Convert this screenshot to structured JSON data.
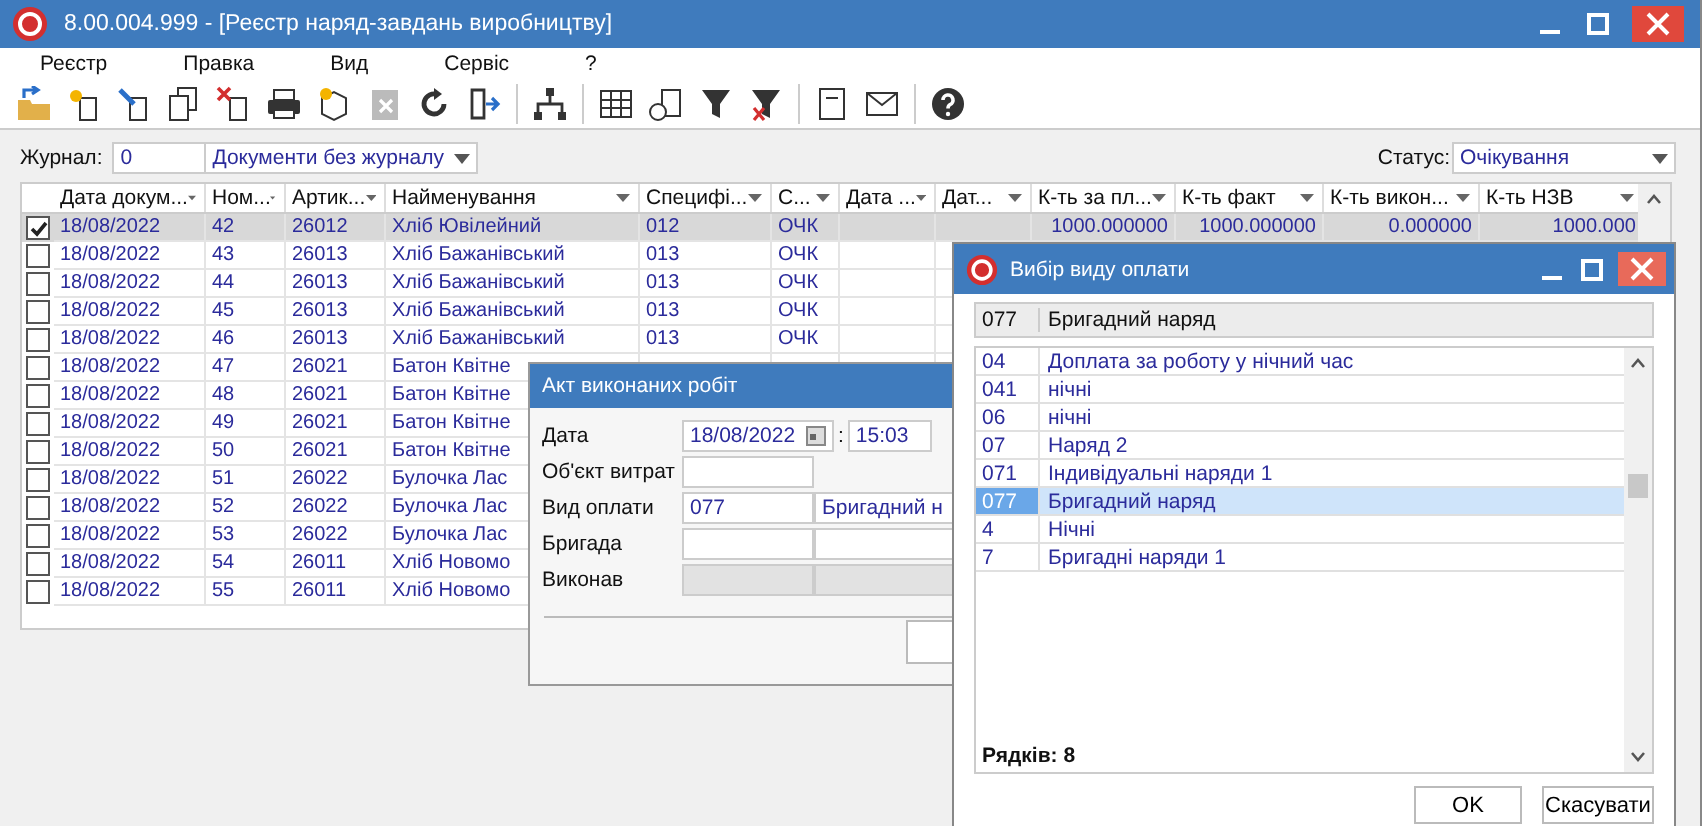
{
  "window": {
    "title": "8.00.004.999 - [Реєстр наряд-завдань виробництву]"
  },
  "menu": [
    "Реєстр",
    "Правка",
    "Вид",
    "Сервіс",
    "?"
  ],
  "journal": {
    "label": "Журнал:",
    "code": "0",
    "value": "Документи без журналу"
  },
  "status": {
    "label": "Статус:",
    "value": "Очікування"
  },
  "table": {
    "columns": [
      "Дата докум...",
      "Ном...",
      "Артик...",
      "Найменування",
      "Специфі...",
      "С...",
      "Дата ...",
      "Дат...",
      "К-ть за пл...",
      "К-ть факт",
      "К-ть викон...",
      "К-ть НЗВ"
    ],
    "rows": [
      {
        "checked": true,
        "selected": true,
        "date": "18/08/2022",
        "number": "42",
        "article": "26012",
        "name": "Хліб Ювілейний",
        "spec": "012",
        "status": "ОЧК",
        "planned": "1000.000000",
        "actual": "1000.000000",
        "done": "0.000000",
        "nzv": "1000.000"
      },
      {
        "checked": false,
        "selected": false,
        "date": "18/08/2022",
        "number": "43",
        "article": "26013",
        "name": "Хліб Бажанівський",
        "spec": "013",
        "status": "ОЧК"
      },
      {
        "checked": false,
        "selected": false,
        "date": "18/08/2022",
        "number": "44",
        "article": "26013",
        "name": "Хліб Бажанівський",
        "spec": "013",
        "status": "ОЧК"
      },
      {
        "checked": false,
        "selected": false,
        "date": "18/08/2022",
        "number": "45",
        "article": "26013",
        "name": "Хліб Бажанівський",
        "spec": "013",
        "status": "ОЧК"
      },
      {
        "checked": false,
        "selected": false,
        "date": "18/08/2022",
        "number": "46",
        "article": "26013",
        "name": "Хліб Бажанівський",
        "spec": "013",
        "status": "ОЧК"
      },
      {
        "checked": false,
        "selected": false,
        "date": "18/08/2022",
        "number": "47",
        "article": "26021",
        "name": "Батон Квітне"
      },
      {
        "checked": false,
        "selected": false,
        "date": "18/08/2022",
        "number": "48",
        "article": "26021",
        "name": "Батон Квітне"
      },
      {
        "checked": false,
        "selected": false,
        "date": "18/08/2022",
        "number": "49",
        "article": "26021",
        "name": "Батон Квітне"
      },
      {
        "checked": false,
        "selected": false,
        "date": "18/08/2022",
        "number": "50",
        "article": "26021",
        "name": "Батон Квітне"
      },
      {
        "checked": false,
        "selected": false,
        "date": "18/08/2022",
        "number": "51",
        "article": "26022",
        "name": "Булочка Лас"
      },
      {
        "checked": false,
        "selected": false,
        "date": "18/08/2022",
        "number": "52",
        "article": "26022",
        "name": "Булочка Лас"
      },
      {
        "checked": false,
        "selected": false,
        "date": "18/08/2022",
        "number": "53",
        "article": "26022",
        "name": "Булочка Лас"
      },
      {
        "checked": false,
        "selected": false,
        "date": "18/08/2022",
        "number": "54",
        "article": "26011",
        "name": "Хліб Новомо"
      },
      {
        "checked": false,
        "selected": false,
        "date": "18/08/2022",
        "number": "55",
        "article": "26011",
        "name": "Хліб Новомо"
      }
    ]
  },
  "act_dialog": {
    "title": "Акт виконаних робіт",
    "fields": [
      {
        "kind": "date",
        "label": "Дата",
        "value": "18/08/2022",
        "separator": ":",
        "time": "15:03",
        "disabled": false
      },
      {
        "kind": "single",
        "label": "Об'єкт витрат",
        "disabled": false
      },
      {
        "kind": "pair",
        "label": "Вид оплати",
        "value": "077",
        "value2": "Бригадний н",
        "disabled": false
      },
      {
        "kind": "pair",
        "label": "Бригада",
        "disabled": false
      },
      {
        "kind": "pair",
        "label": "Виконав",
        "disabled": true
      }
    ]
  },
  "payment_dialog": {
    "title": "Вибір виду оплати",
    "current": {
      "code": "077",
      "name": "Бригадний наряд"
    },
    "items": [
      {
        "code": "04",
        "name": "Доплата за роботу у нічний час",
        "selected": false
      },
      {
        "code": "041",
        "name": "нічні",
        "selected": false
      },
      {
        "code": "06",
        "name": "нічні",
        "selected": false
      },
      {
        "code": "07",
        "name": "Наряд 2",
        "selected": false
      },
      {
        "code": "071",
        "name": "Індивідуальні наряди 1",
        "selected": false
      },
      {
        "code": "077",
        "name": "Бригадний наряд",
        "selected": true
      },
      {
        "code": "4",
        "name": "Нічні",
        "selected": false
      },
      {
        "code": "7",
        "name": "Бригадні наряди 1",
        "selected": false
      }
    ],
    "row_count": "Рядків: 8",
    "buttons": [
      "OK",
      "Скасувати"
    ]
  }
}
